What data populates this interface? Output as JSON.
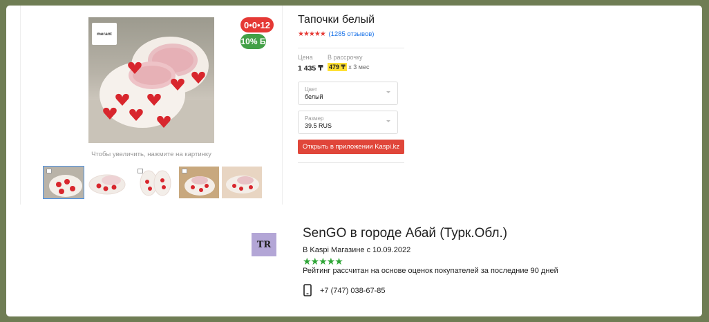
{
  "product": {
    "title": "Тапочки белый",
    "stars": "★★★★★",
    "reviews_link": "(1285 отзывов)",
    "zoom_hint": "Чтобы увеличить, нажмите на картинку",
    "brand_logo_text": "merant",
    "badges": {
      "installment": "0•0•12",
      "bonus": "10% Б"
    }
  },
  "pricing": {
    "price_label": "Цена",
    "price_value": "1 435 ₸",
    "installment_label": "В рассрочку",
    "installment_value": "479 ₸",
    "installment_term": "х 3 мес"
  },
  "options": {
    "color": {
      "label": "Цвет",
      "value": "белый"
    },
    "size": {
      "label": "Размер",
      "value": "39.5 RUS"
    }
  },
  "actions": {
    "open_in_app": "Открыть в приложении Kaspi.kz"
  },
  "seller": {
    "logo_text": "TR",
    "name": "SenGO в городе Абай (Турк.Обл.)",
    "since": "В Kaspi Магазине с 10.09.2022",
    "stars": "★★★★★",
    "rating_note": "Рейтинг рассчитан на основе оценок покупателей за последние 90 дней",
    "phone": "+7 (747) 038-67-85"
  },
  "colors": {
    "accent_red": "#e0463a",
    "badge_red": "#e53935",
    "badge_green": "#43a047",
    "star_red": "#e53935",
    "star_green": "#2ea536",
    "link_blue": "#1a73e8",
    "highlight_yellow": "#ffe033",
    "page_bg": "#6f7d54"
  },
  "icons": [
    "chevron-down-icon",
    "phone-icon"
  ]
}
